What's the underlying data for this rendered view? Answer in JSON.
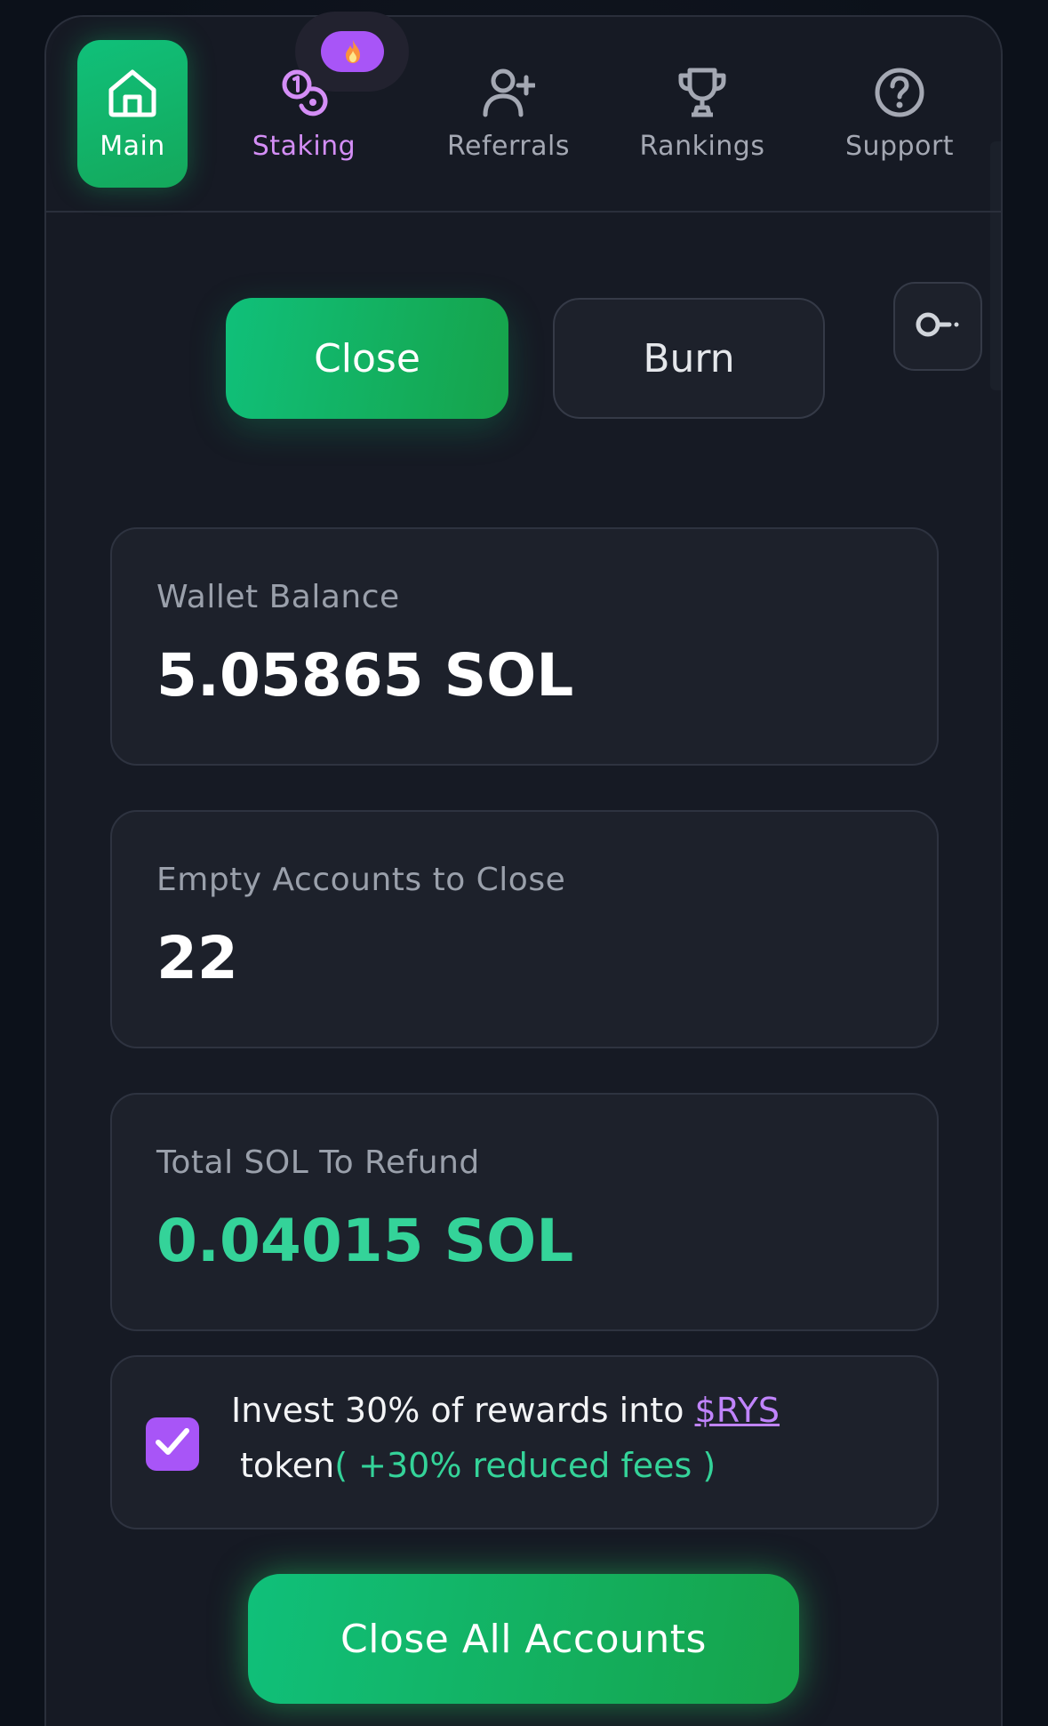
{
  "nav": {
    "items": [
      {
        "id": "main",
        "label": "Main",
        "icon": "home-icon",
        "active": true
      },
      {
        "id": "staking",
        "label": "Staking",
        "icon": "coins-icon",
        "active": false
      },
      {
        "id": "referrals",
        "label": "Referrals",
        "icon": "user-plus-icon",
        "active": false
      },
      {
        "id": "rankings",
        "label": "Rankings",
        "icon": "trophy-icon",
        "active": false
      },
      {
        "id": "support",
        "label": "Support",
        "icon": "help-circle-icon",
        "active": false
      }
    ],
    "staking_badge_icon": "flame-icon"
  },
  "mode_toggle": {
    "close_label": "Close",
    "burn_label": "Burn",
    "selected": "Close",
    "key_icon": "key-icon"
  },
  "stats": {
    "wallet_balance": {
      "label": "Wallet Balance",
      "value": "5.05865 SOL"
    },
    "empty_accounts": {
      "label": "Empty Accounts to Close",
      "value": "22"
    },
    "total_refund": {
      "label": "Total SOL To Refund",
      "value": "0.04015 SOL"
    }
  },
  "invest_option": {
    "checked": true,
    "text_prefix": "Invest 30% of rewards into ",
    "token_link": "$RYS",
    "text_suffix": "token",
    "bonus": "( +30% reduced fees )"
  },
  "cta": {
    "label": "Close All Accounts"
  },
  "colors": {
    "accent_green": "#10c07a",
    "accent_purple": "#a855f7",
    "value_green": "#34d399",
    "card_bg": "#1d212b",
    "page_bg": "#0c111a"
  }
}
